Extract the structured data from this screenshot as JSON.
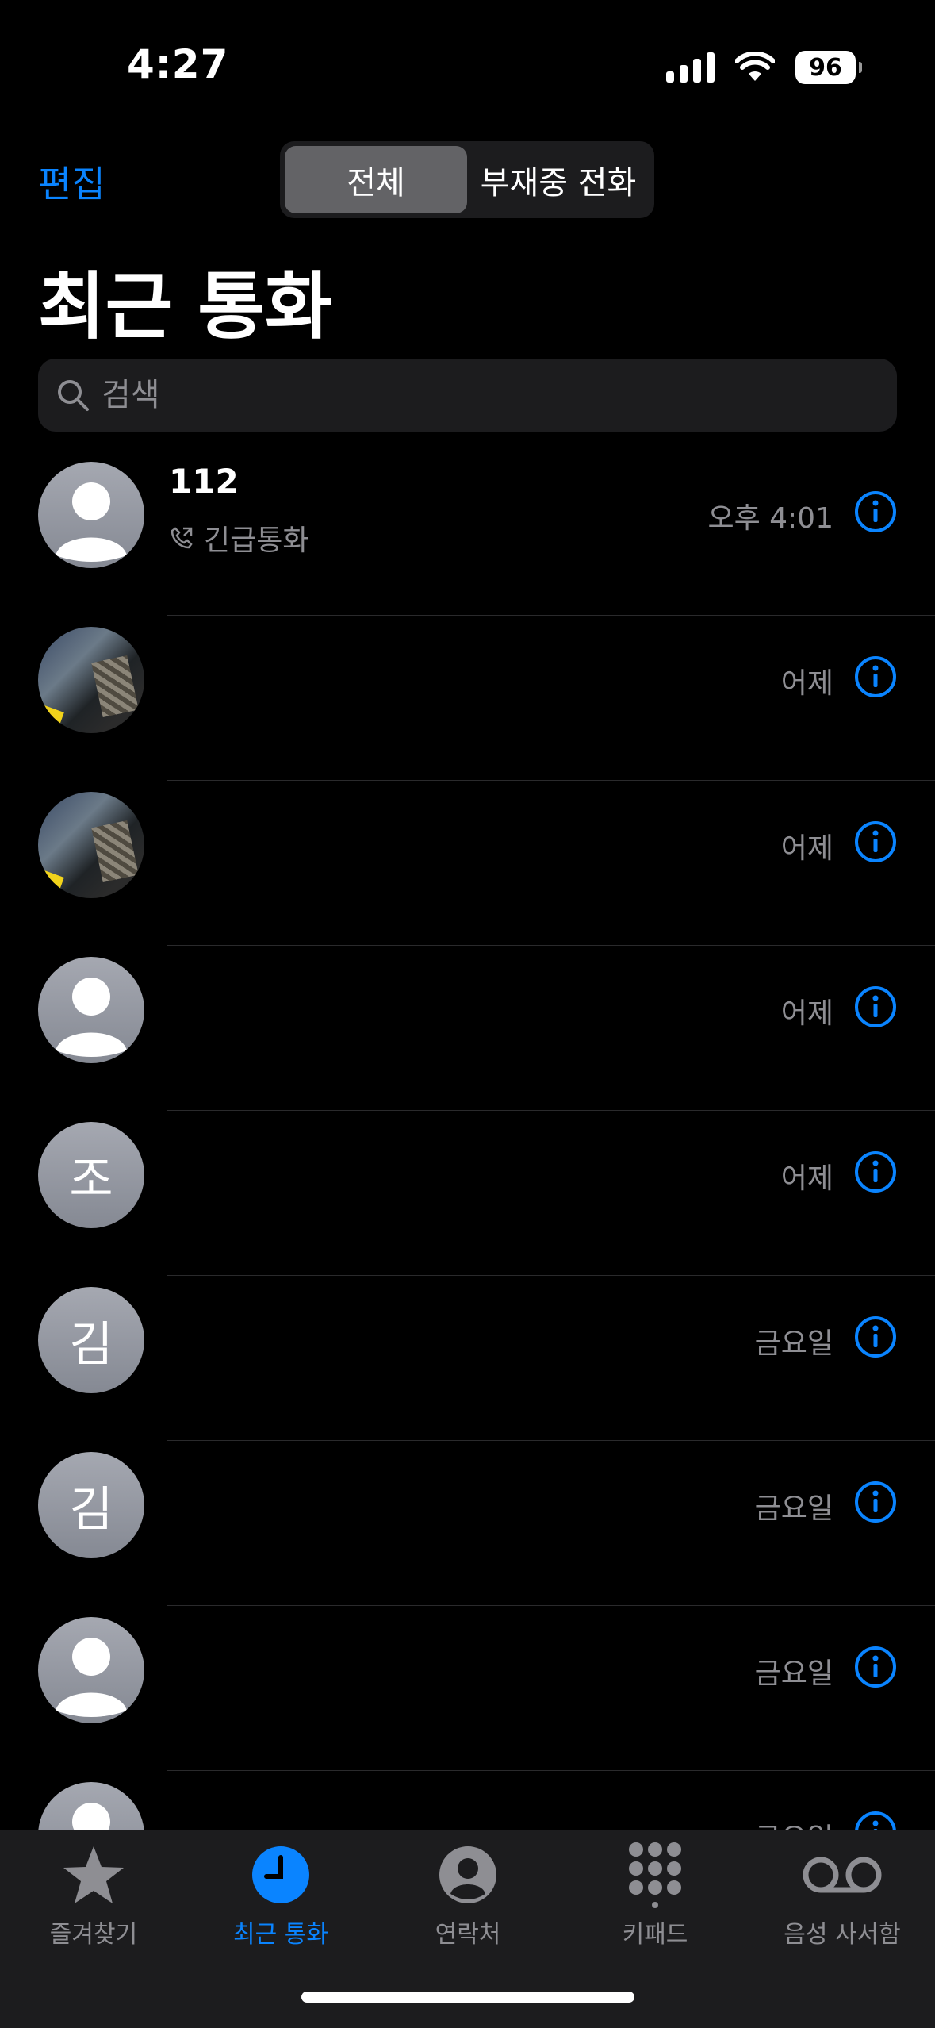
{
  "status_bar": {
    "time": "4:27",
    "battery": "96"
  },
  "nav": {
    "edit": "편집",
    "segments": [
      "전체",
      "부재중 전화"
    ],
    "title": "최근 통화"
  },
  "search": {
    "placeholder": "검색"
  },
  "calls": [
    {
      "name": "112",
      "detail": "긴급통화",
      "time": "오후 4:01",
      "avatar": "person-icon"
    },
    {
      "name": "",
      "time": "어제",
      "avatar": "photo"
    },
    {
      "name": "",
      "time": "어제",
      "avatar": "photo"
    },
    {
      "name": "",
      "time": "어제",
      "avatar": "person-icon"
    },
    {
      "name": "",
      "time": "어제",
      "avatar": "initial",
      "initial": "조"
    },
    {
      "name": "",
      "time": "금요일",
      "avatar": "initial",
      "initial": "김"
    },
    {
      "name": "",
      "time": "금요일",
      "avatar": "initial",
      "initial": "김"
    },
    {
      "name": "",
      "time": "금요일",
      "avatar": "person-icon"
    },
    {
      "name": "",
      "time": "금요일",
      "avatar": "person-icon"
    }
  ],
  "tabs": [
    {
      "label": "즐겨찾기",
      "icon": "star-icon"
    },
    {
      "label": "최근 통화",
      "icon": "clock-icon",
      "active": true
    },
    {
      "label": "연락처",
      "icon": "contact-icon"
    },
    {
      "label": "키패드",
      "icon": "keypad-icon"
    },
    {
      "label": "음성 사서함",
      "icon": "voicemail-icon"
    }
  ],
  "colors": {
    "accent": "#0a84ff",
    "background": "#000000",
    "secondary_text": "#8e8e93"
  }
}
